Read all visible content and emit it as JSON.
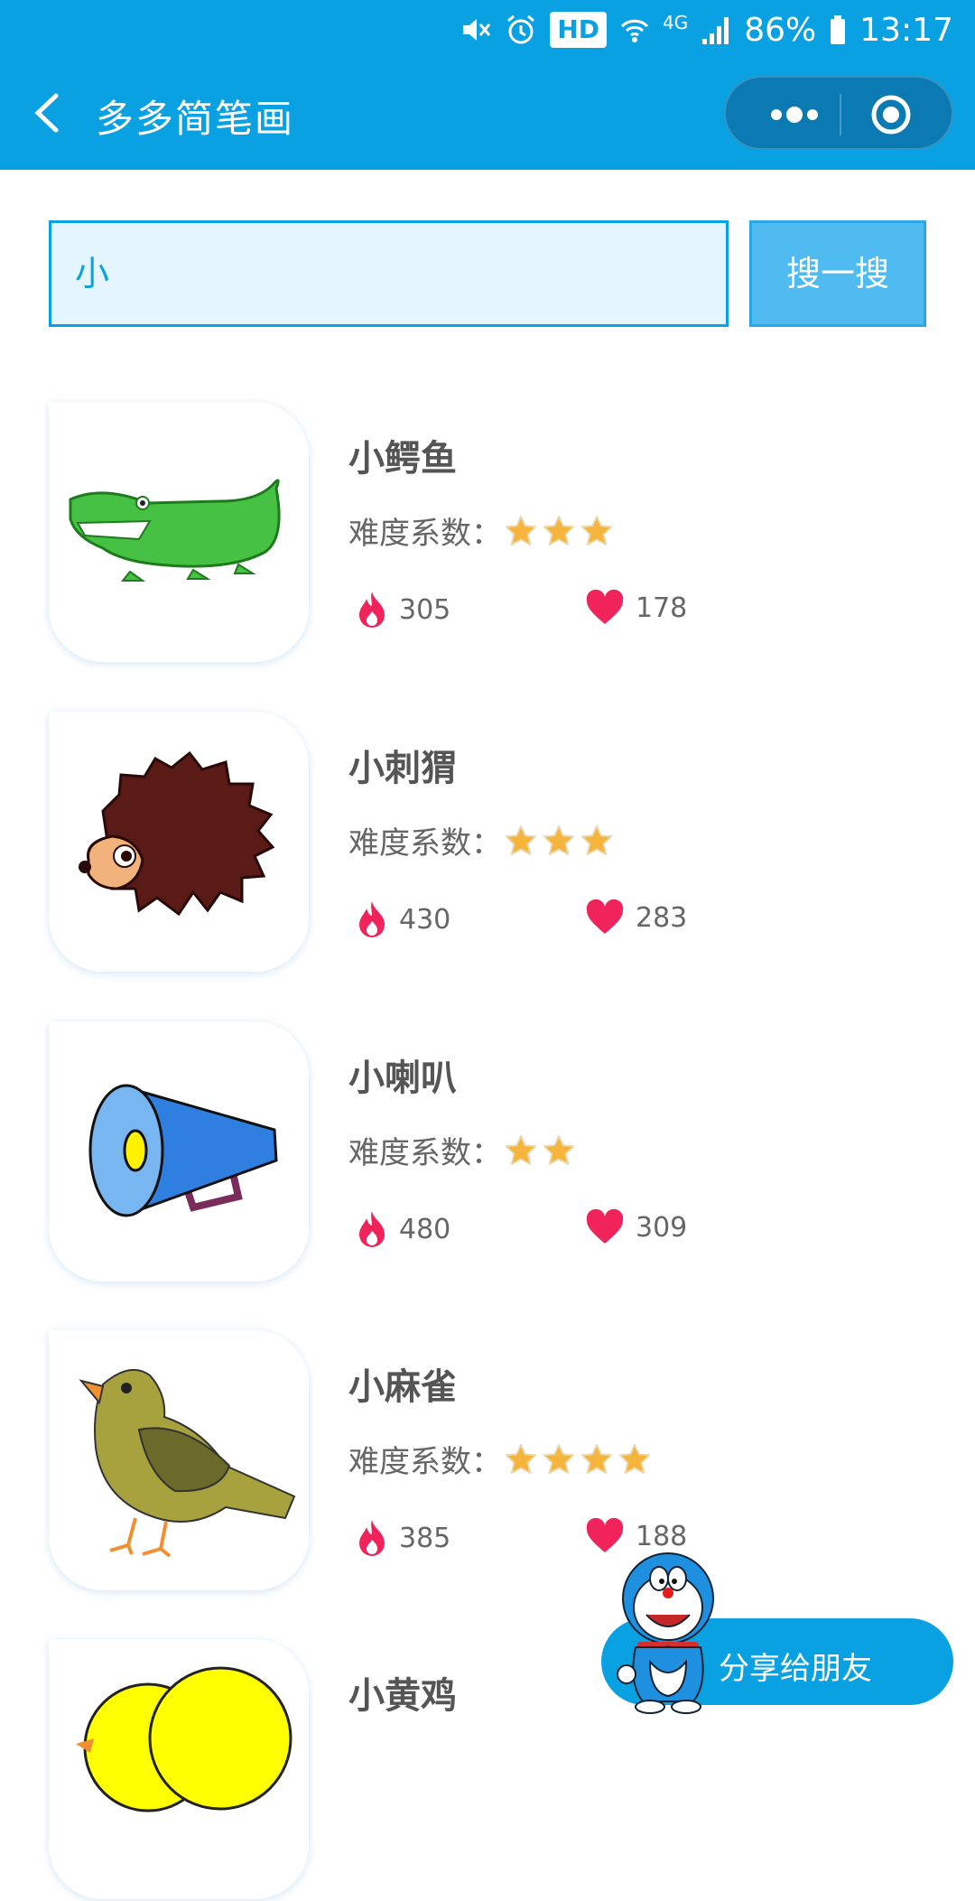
{
  "status_bar": {
    "battery": "86%",
    "time": "13:17",
    "network": "4G",
    "hd": "HD"
  },
  "nav": {
    "title": "多多简笔画"
  },
  "search": {
    "value": "小",
    "button_label": "搜一搜"
  },
  "difficulty_label": "难度系数：",
  "items": [
    {
      "name": "小鳄鱼",
      "stars": 3,
      "hot": "305",
      "likes": "178",
      "image": "crocodile"
    },
    {
      "name": "小刺猬",
      "stars": 3,
      "hot": "430",
      "likes": "283",
      "image": "hedgehog"
    },
    {
      "name": "小喇叭",
      "stars": 2,
      "hot": "480",
      "likes": "309",
      "image": "megaphone"
    },
    {
      "name": "小麻雀",
      "stars": 4,
      "hot": "385",
      "likes": "188",
      "image": "sparrow"
    },
    {
      "name": "小黄鸡",
      "image": "chick"
    }
  ],
  "share": {
    "label": "分享给朋友"
  },
  "colors": {
    "primary": "#0aa1e3",
    "star": "#f5b43c",
    "hot": "#f0245a",
    "like": "#f0245a"
  }
}
